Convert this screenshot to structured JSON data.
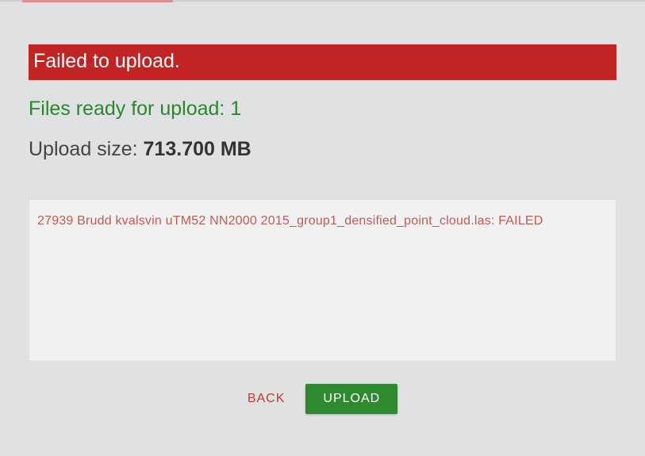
{
  "banner": {
    "error_text": "Failed to upload."
  },
  "status": {
    "ready_label": "Files ready for upload:",
    "ready_count": "1",
    "size_label": "Upload size:",
    "size_value": "713.700 MB"
  },
  "log": {
    "entries": [
      "27939 Brudd kvalsvin uTM52 NN2000 2015_group1_densified_point_cloud.las: FAILED"
    ]
  },
  "actions": {
    "back_label": "BACK",
    "upload_label": "UPLOAD"
  }
}
